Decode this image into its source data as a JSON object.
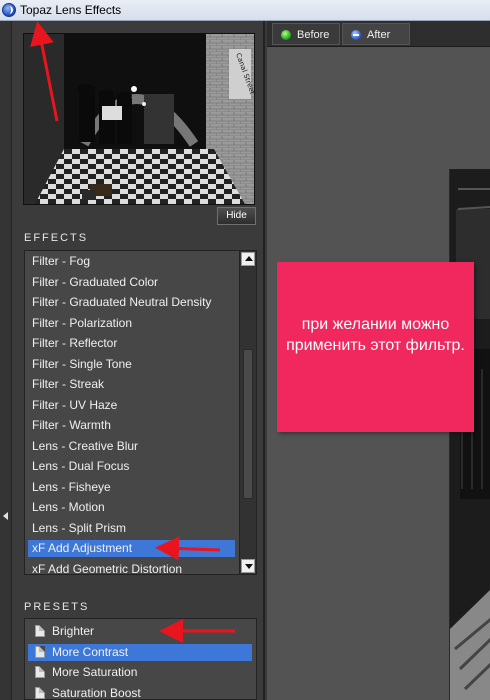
{
  "window": {
    "title": "Topaz Lens Effects",
    "icon": "topaz-logo-icon"
  },
  "preview": {
    "hide_label": "Hide",
    "sign_text": "Canal Street"
  },
  "effects": {
    "title": "EFFECTS",
    "items": [
      "Filter - Fog",
      "Filter - Graduated Color",
      "Filter - Graduated Neutral Density",
      "Filter - Polarization",
      "Filter - Reflector",
      "Filter - Single Tone",
      "Filter - Streak",
      "Filter - UV Haze",
      "Filter - Warmth",
      "Lens - Creative Blur",
      "Lens - Dual Focus",
      "Lens - Fisheye",
      "Lens - Motion",
      "Lens - Split Prism",
      "xF Add Adjustment",
      "xF Add Geometric Distortion"
    ],
    "selected": "xF Add Adjustment"
  },
  "presets": {
    "title": "PRESETS",
    "items": [
      "Brighter",
      "More Contrast",
      "More Saturation",
      "Saturation Boost"
    ],
    "selected": "More Contrast"
  },
  "tabs": {
    "before": "Before",
    "after": "After",
    "active": "After"
  },
  "annotation": {
    "text": "при желании можно применить этот фильтр.",
    "color": "#f0285d",
    "arrow_color": "#e8141e"
  },
  "colors": {
    "selection": "#3d78d9",
    "panel": "#3b3b3b",
    "list_bg": "#474747"
  }
}
